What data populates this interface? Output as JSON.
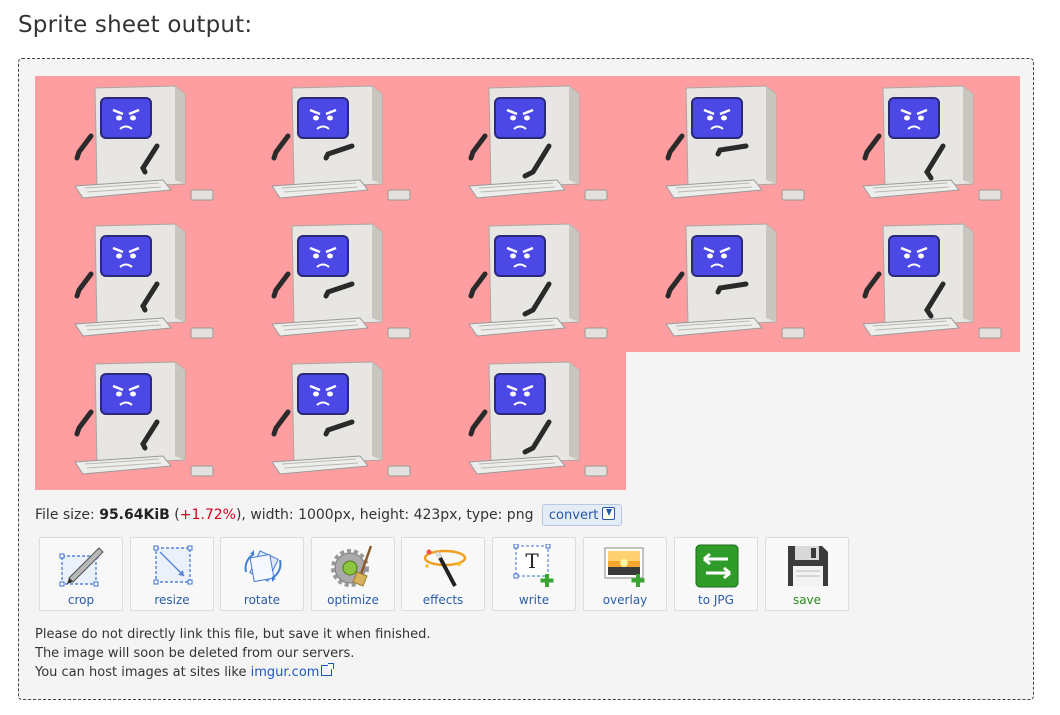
{
  "title": "Sprite sheet output:",
  "sheet": {
    "background_color": "#ff9ea0",
    "frame_count": 13,
    "columns": 5,
    "rows": 3,
    "sprite_description_icon": "angry-computer-icon"
  },
  "info": {
    "label_size": "File size:",
    "size": "95.64KiB",
    "change_open": "(",
    "change": "+1.72%",
    "change_close": ")",
    "dims": ", width: 1000px, height: 423px, type: png",
    "convert_label": "convert"
  },
  "tools": [
    {
      "label": "crop",
      "icon": "crop-icon"
    },
    {
      "label": "resize",
      "icon": "resize-icon"
    },
    {
      "label": "rotate",
      "icon": "rotate-icon"
    },
    {
      "label": "optimize",
      "icon": "optimize-icon"
    },
    {
      "label": "effects",
      "icon": "effects-icon"
    },
    {
      "label": "write",
      "icon": "write-text-icon"
    },
    {
      "label": "overlay",
      "icon": "overlay-icon"
    },
    {
      "label": "to JPG",
      "icon": "convert-jpg-icon"
    },
    {
      "label": "save",
      "icon": "floppy-disk-icon"
    }
  ],
  "notes": {
    "line1": "Please do not directly link this file, but save it when finished.",
    "line2": "The image will soon be deleted from our servers.",
    "line3_prefix": "You can host images at sites like ",
    "link": "imgur.com"
  },
  "colors": {
    "link": "#1f58b8",
    "pct": "#d8001c",
    "save_label": "#2c8a1c"
  }
}
